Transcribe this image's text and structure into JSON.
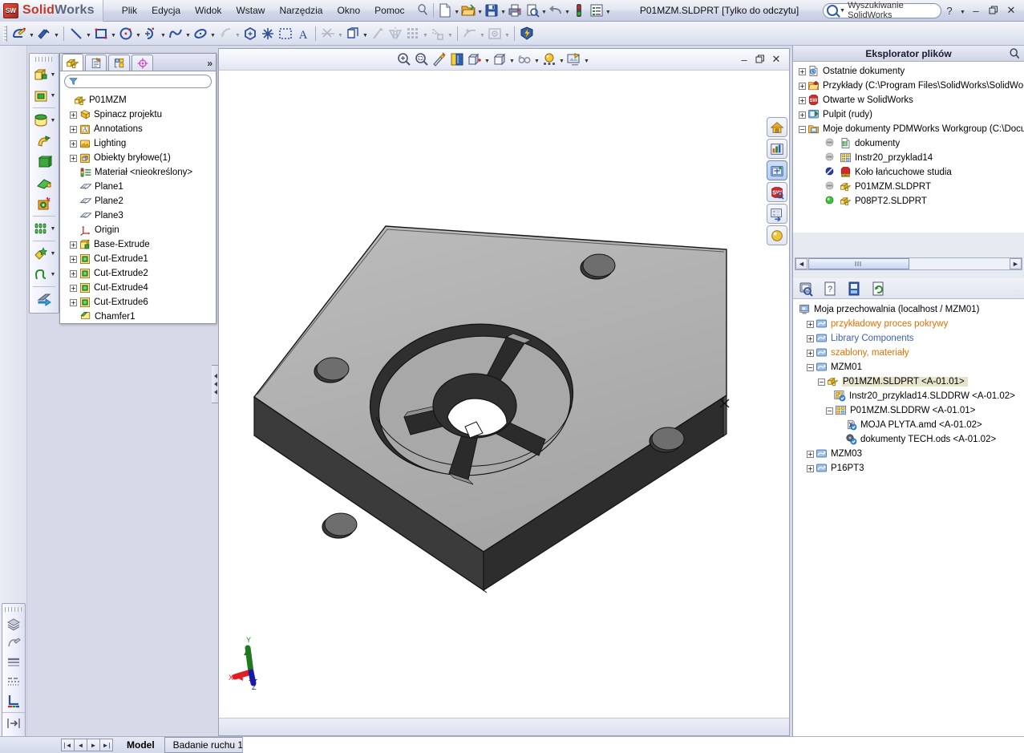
{
  "app": {
    "brand_solid": "Solid",
    "brand_works": "Works",
    "logo_text": "SW",
    "document_title": "P01MZM.SLDPRT [Tylko do odczytu]",
    "accent_red": "#c0392b",
    "accent_blue": "#2c5fa8",
    "titlebar_bg": "#d3d8ea"
  },
  "menubar": {
    "items": [
      {
        "label": "Plik"
      },
      {
        "label": "Edycja"
      },
      {
        "label": "Widok"
      },
      {
        "label": "Wstaw"
      },
      {
        "label": "Narzędzia"
      },
      {
        "label": "Okno"
      },
      {
        "label": "Pomoc"
      }
    ],
    "pin_icon": "pushpin-icon"
  },
  "quick_toolbar": {
    "buttons": [
      {
        "name": "new-document-icon",
        "has_arrow": true
      },
      {
        "name": "open-document-icon",
        "has_arrow": true
      },
      {
        "name": "save-icon",
        "has_arrow": true
      },
      {
        "name": "print-icon",
        "has_arrow": false
      },
      {
        "name": "print-preview-icon",
        "has_arrow": false
      },
      {
        "name": "undo-icon",
        "has_arrow": true
      },
      {
        "name": "rebuild-status-icon",
        "has_arrow": false
      },
      {
        "name": "options-icon",
        "has_arrow": true
      }
    ]
  },
  "search": {
    "placeholder": "Wyszukiwanie SolidWorks",
    "icon": "search-icon",
    "dropdown_icon": "chevron-down-icon"
  },
  "window_controls": {
    "help_label": "?",
    "help_arrow": "chevron-down-icon",
    "minimize": "minimize-icon",
    "restore": "restore-icon",
    "close": "close-icon"
  },
  "sketch_toolbar": {
    "buttons": [
      {
        "name": "sketch-icon",
        "arrow": true
      },
      {
        "name": "smart-dimension-icon",
        "arrow": true
      },
      {
        "name": "line-icon",
        "arrow": true
      },
      {
        "name": "rectangle-icon",
        "arrow": true
      },
      {
        "name": "circle-icon",
        "arrow": true
      },
      {
        "name": "arc-icon",
        "arrow": true
      },
      {
        "name": "spline-icon",
        "arrow": true
      },
      {
        "name": "ellipse-icon",
        "arrow": true
      },
      {
        "name": "fillet-icon",
        "arrow": true,
        "disabled": true
      },
      {
        "name": "polygon-icon",
        "arrow": false
      },
      {
        "name": "point-icon",
        "arrow": false
      },
      {
        "name": "construction-geometry-icon",
        "arrow": false
      },
      {
        "name": "text-icon",
        "arrow": false
      },
      {
        "name": "trim-entities-icon",
        "arrow": true,
        "disabled": true
      },
      {
        "name": "convert-entities-icon",
        "arrow": true
      },
      {
        "name": "offset-entities-icon",
        "arrow": false,
        "disabled": true
      },
      {
        "name": "mirror-entities-icon",
        "arrow": false,
        "disabled": true
      },
      {
        "name": "linear-pattern-icon",
        "arrow": true,
        "disabled": true
      },
      {
        "name": "move-entities-icon",
        "arrow": true,
        "disabled": true
      },
      {
        "name": "display-delete-relations-icon",
        "arrow": true,
        "disabled": true
      },
      {
        "name": "repair-sketch-icon",
        "arrow": true,
        "disabled": true
      },
      {
        "name": "quick-snaps-icon",
        "arrow": false
      }
    ]
  },
  "features_toolbar": {
    "buttons": [
      {
        "name": "extruded-boss-base-icon",
        "arrow": true
      },
      {
        "name": "extruded-cut-icon",
        "arrow": true
      },
      {
        "name": "revolved-boss-base-icon",
        "arrow": true
      },
      {
        "name": "swept-boss-base-icon",
        "arrow": false
      },
      {
        "name": "lofted-boss-base-icon",
        "arrow": false
      },
      {
        "name": "rib-icon",
        "arrow": false
      },
      {
        "name": "hole-wizard-icon",
        "arrow": false
      },
      {
        "name": "linear-pattern-icon",
        "arrow": true
      },
      {
        "name": "reference-geometry-icon",
        "arrow": true
      },
      {
        "name": "curves-icon",
        "arrow": true
      },
      {
        "name": "instant3d-icon",
        "arrow": false
      }
    ]
  },
  "left_bottom_toolbar": {
    "buttons": [
      {
        "name": "layers-icon"
      },
      {
        "name": "display-style-icon"
      },
      {
        "name": "line-style-icon"
      },
      {
        "name": "line-thickness-icon"
      },
      {
        "name": "hide-edges-icon"
      },
      {
        "name": "collapse-right-icon"
      },
      {
        "name": "collapse-left-icon"
      }
    ]
  },
  "feature_manager": {
    "tabs": [
      {
        "name": "feature-manager-tab",
        "icon": "feature-tree-icon",
        "active": true
      },
      {
        "name": "property-manager-tab",
        "icon": "property-icon",
        "active": false
      },
      {
        "name": "configuration-manager-tab",
        "icon": "configuration-icon",
        "active": false
      },
      {
        "name": "dimxpert-manager-tab",
        "icon": "dimxpert-icon",
        "active": false
      }
    ],
    "more_tabs_label": "»",
    "filter": {
      "placeholder": "",
      "value": "",
      "icon": "filter-icon"
    },
    "tree": [
      {
        "label": "P01MZM",
        "icon": "part-icon",
        "indent": 0,
        "expander": "none"
      },
      {
        "label": "Spinacz projektu",
        "icon": "design-binder-icon",
        "indent": 1,
        "expander": "plus"
      },
      {
        "label": "Annotations",
        "icon": "annotations-icon",
        "indent": 1,
        "expander": "plus"
      },
      {
        "label": "Lighting",
        "icon": "lighting-icon",
        "indent": 1,
        "expander": "plus"
      },
      {
        "label": "Obiekty bryłowe(1)",
        "icon": "solid-bodies-icon",
        "indent": 1,
        "expander": "plus"
      },
      {
        "label": "Materiał <nieokreślony>",
        "icon": "material-icon",
        "indent": 1,
        "expander": "none"
      },
      {
        "label": "Plane1",
        "icon": "plane-icon",
        "indent": 1,
        "expander": "none"
      },
      {
        "label": "Plane2",
        "icon": "plane-icon",
        "indent": 1,
        "expander": "none"
      },
      {
        "label": "Plane3",
        "icon": "plane-icon",
        "indent": 1,
        "expander": "none"
      },
      {
        "label": "Origin",
        "icon": "origin-icon",
        "indent": 1,
        "expander": "none"
      },
      {
        "label": "Base-Extrude",
        "icon": "boss-extrude-icon",
        "indent": 1,
        "expander": "plus"
      },
      {
        "label": "Cut-Extrude1",
        "icon": "cut-extrude-icon",
        "indent": 1,
        "expander": "plus"
      },
      {
        "label": "Cut-Extrude2",
        "icon": "cut-extrude-icon",
        "indent": 1,
        "expander": "plus"
      },
      {
        "label": "Cut-Extrude4",
        "icon": "cut-extrude-icon",
        "indent": 1,
        "expander": "plus"
      },
      {
        "label": "Cut-Extrude6",
        "icon": "cut-extrude-icon",
        "indent": 1,
        "expander": "plus"
      },
      {
        "label": "Chamfer1",
        "icon": "chamfer-icon",
        "indent": 1,
        "expander": "none"
      }
    ]
  },
  "view_toolbar": {
    "buttons": [
      {
        "name": "zoom-to-fit-icon",
        "arrow": false
      },
      {
        "name": "zoom-to-area-icon",
        "arrow": false
      },
      {
        "name": "previous-view-icon",
        "arrow": false
      },
      {
        "name": "section-view-icon",
        "arrow": false
      },
      {
        "name": "view-orientation-icon",
        "arrow": true
      },
      {
        "name": "display-style-icon",
        "arrow": true
      },
      {
        "name": "hide-show-items-icon",
        "arrow": true
      },
      {
        "name": "apply-scene-icon",
        "arrow": true
      },
      {
        "name": "view-settings-icon",
        "arrow": true
      }
    ],
    "window_buttons": {
      "minimize": "minimize-icon",
      "restore": "restore-icon",
      "close": "close-icon"
    }
  },
  "view_side_toolbar": {
    "buttons": [
      {
        "name": "home-icon",
        "selected": false
      },
      {
        "name": "solidworks-resources-icon",
        "selected": false
      },
      {
        "name": "design-library-icon",
        "selected": true
      },
      {
        "name": "file-explorer-icon",
        "selected": false
      },
      {
        "name": "view-palette-icon",
        "selected": false
      },
      {
        "name": "appearances-scenes-icon",
        "selected": false
      }
    ]
  },
  "triad": {
    "x_label": "X",
    "y_label": "Y",
    "z_label": "Z",
    "x_color": "#e02020",
    "y_color": "#1f7a1f",
    "z_color": "#1a1aa8"
  },
  "file_explorer": {
    "title": "Eksplorator plików",
    "pin_icon": "pushpin-icon",
    "tree": [
      {
        "label": "Ostatnie dokumenty",
        "icon": "recent-documents-icon",
        "indent": 0,
        "expander": "plus"
      },
      {
        "label": "Przykłady (C:\\Program Files\\SolidWorks\\SolidWorks",
        "icon": "samples-folder-icon",
        "indent": 0,
        "expander": "plus"
      },
      {
        "label": "Otwarte w SolidWorks",
        "icon": "solidworks-icon",
        "indent": 0,
        "expander": "plus"
      },
      {
        "label": "Pulpit (rudy)",
        "icon": "desktop-icon",
        "indent": 0,
        "expander": "plus"
      },
      {
        "label": "Moje dokumenty PDMWorks Workgroup (C:\\Docume",
        "icon": "pdmworks-folder-icon",
        "indent": 0,
        "expander": "minus"
      },
      {
        "label": "dokumenty",
        "icon": "spreadsheet-icon",
        "indent": 2,
        "expander": "none",
        "status": "gray"
      },
      {
        "label": "Instr20_przyklad14",
        "icon": "drawing-icon",
        "indent": 2,
        "expander": "none",
        "status": "gray"
      },
      {
        "label": "Koło łańcuchowe studia",
        "icon": "dwg-icon",
        "indent": 2,
        "expander": "none",
        "status": "blocked"
      },
      {
        "label": "P01MZM.SLDPRT",
        "icon": "part-icon",
        "indent": 2,
        "expander": "none",
        "status": "gray"
      },
      {
        "label": "P08PT2.SLDPRT",
        "icon": "part-icon",
        "indent": 2,
        "expander": "none",
        "status": "green"
      }
    ],
    "hscrollbar": {
      "left_icon": "chevron-left-icon",
      "right_icon": "chevron-right-icon"
    }
  },
  "vault": {
    "toolbar": [
      {
        "name": "search-vault-icon"
      },
      {
        "name": "help-icon"
      },
      {
        "name": "checkin-icon"
      },
      {
        "name": "refresh-icon"
      }
    ],
    "root": {
      "label": "Moja przechowalnia (localhost / MZM01)",
      "icon": "vault-root-icon"
    },
    "tree": [
      {
        "label": "przykładowy proces pokrywy",
        "icon": "vault-folder-icon",
        "indent": 1,
        "expander": "plus",
        "color": "#e07000"
      },
      {
        "label": "Library Components",
        "icon": "vault-folder-icon",
        "indent": 1,
        "expander": "plus",
        "color": "#3a5fb0"
      },
      {
        "label": "szablony, materiały",
        "icon": "vault-folder-icon",
        "indent": 1,
        "expander": "plus",
        "color": "#e07000"
      },
      {
        "label": "MZM01",
        "icon": "vault-folder-icon",
        "indent": 1,
        "expander": "minus",
        "color": "#000000"
      },
      {
        "label": "P01MZM.SLDPRT <A-01.01>",
        "icon": "part-icon",
        "indent": 2,
        "expander": "minus",
        "color": "#000000",
        "selected": true
      },
      {
        "label": "Instr20_przyklad14.SLDDRW <A-01.02>",
        "icon": "drawing-checked-icon",
        "indent": 3,
        "expander": "none",
        "color": "#000000"
      },
      {
        "label": "P01MZM.SLDDRW <A-01.01>",
        "icon": "drawing-icon",
        "indent": 3,
        "expander": "minus",
        "color": "#000000"
      },
      {
        "label": "MOJA PLYTA.amd <A-01.02>",
        "icon": "amd-file-icon",
        "indent": 4,
        "expander": "none",
        "color": "#000000"
      },
      {
        "label": "dokumenty TECH.ods <A-01.02>",
        "icon": "ods-file-icon",
        "indent": 4,
        "expander": "none",
        "color": "#000000"
      },
      {
        "label": "MZM03",
        "icon": "vault-folder-icon",
        "indent": 1,
        "expander": "plus",
        "color": "#000000"
      },
      {
        "label": "P16PT3",
        "icon": "vault-folder-icon",
        "indent": 1,
        "expander": "plus",
        "color": "#000000"
      }
    ]
  },
  "statusbar": {
    "nav_buttons": [
      "first-tab-icon",
      "previous-tab-icon",
      "next-tab-icon",
      "last-tab-icon"
    ],
    "tabs": [
      {
        "label": "Model",
        "active": true
      },
      {
        "label": "Badanie ruchu 1",
        "active": false
      }
    ]
  },
  "model": {
    "name": "P01MZM",
    "face_top_color": "#b0b0b0",
    "face_side_color": "#2b2b2b",
    "face_front_color": "#3a3a3a",
    "edge_color": "#1a1a1a",
    "hole_count": 4,
    "spoke_count": 4
  }
}
